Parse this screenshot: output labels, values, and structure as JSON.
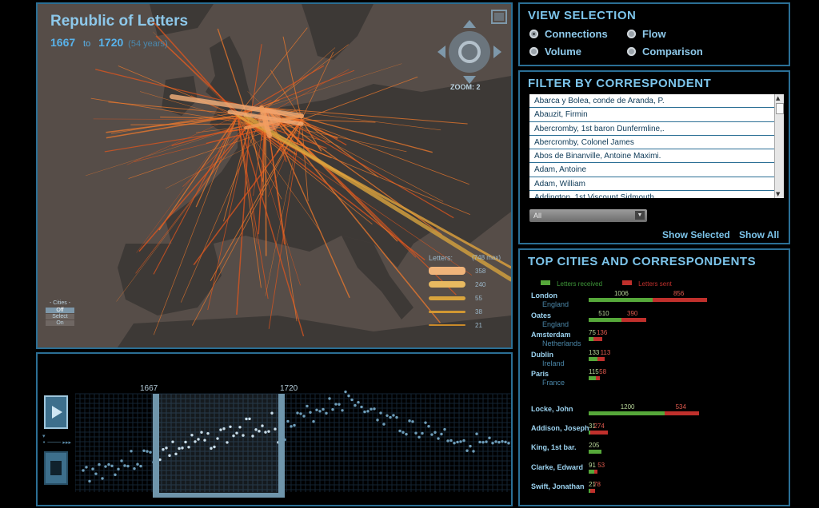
{
  "map": {
    "title": "Republic of Letters",
    "start_year": "1667",
    "to_label": "to",
    "end_year": "1720",
    "duration": "(54 years)",
    "zoom_label": "ZOOM:",
    "zoom_value": "2",
    "cities_toggle": {
      "title": "- Cities -",
      "options": [
        "Off",
        "Select",
        "On"
      ],
      "selected": "Off"
    },
    "legend": {
      "title": "Letters:",
      "max": "(748 max)",
      "entries": [
        {
          "value": "358",
          "color": "#f0b47a"
        },
        {
          "value": "240",
          "color": "#e8b960"
        },
        {
          "value": "55",
          "color": "#d9a43d"
        },
        {
          "value": "38",
          "color": "#d19732"
        },
        {
          "value": "21",
          "color": "#c98a2a"
        }
      ]
    }
  },
  "timeline": {
    "range_start_label": "1667",
    "range_end_label": "1720",
    "play_icon": "play-icon",
    "stop_icon": "stop-icon"
  },
  "view_selection": {
    "title": "VIEW SELECTION",
    "options": [
      {
        "label": "Connections",
        "selected": true
      },
      {
        "label": "Flow",
        "selected": false
      },
      {
        "label": "Volume",
        "selected": false
      },
      {
        "label": "Comparison",
        "selected": false
      }
    ]
  },
  "filter": {
    "title": "FILTER BY CORRESPONDENT",
    "correspondents": [
      "Abarca y Bolea, conde de Aranda, P.",
      "Abauzit, Firmin",
      "Abercromby, 1st baron Dunfermline,.",
      "Abercromby, Colonel James",
      "Abos de Binanville, Antoine Maximi.",
      "Adam, Antoine",
      "Adam, William",
      "Addington, 1st Viscount Sidmouth"
    ],
    "dropdown_value": "All",
    "show_selected": "Show Selected",
    "show_all": "Show All"
  },
  "top": {
    "title": "TOP CITIES AND CORRESPONDENTS",
    "legend_received": "Letters received",
    "legend_sent": "Letters sent",
    "received_color": "#56a83a",
    "sent_color": "#c0302c",
    "cities": [
      {
        "name": "London",
        "country": "England",
        "received": "1006",
        "sent": "856",
        "r": 1006,
        "s": 856
      },
      {
        "name": "Oates",
        "country": "England",
        "received": "510",
        "sent": "390",
        "r": 510,
        "s": 390
      },
      {
        "name": "Amsterdam",
        "country": "Netherlands",
        "received": "75",
        "sent": "136",
        "r": 75,
        "s": 136
      },
      {
        "name": "Dublin",
        "country": "Ireland",
        "received": "133",
        "sent": "113",
        "r": 133,
        "s": 113
      },
      {
        "name": "Paris",
        "country": "France",
        "received": "115",
        "sent": "58",
        "r": 115,
        "s": 58
      }
    ],
    "correspondents": [
      {
        "name": "Locke, John",
        "received": "1200",
        "sent": "534",
        "r": 1200,
        "s": 534
      },
      {
        "name": "Addison, Joseph",
        "received": "31",
        "sent": "274",
        "r": 31,
        "s": 274
      },
      {
        "name": "King, 1st bar.",
        "received": "205",
        "sent": "",
        "r": 205,
        "s": 0
      },
      {
        "name": "Clarke, Edward",
        "received": "91",
        "sent": "53",
        "r": 91,
        "s": 53
      },
      {
        "name": "Swift, Jonathan",
        "received": "21",
        "sent": "78",
        "r": 21,
        "s": 78
      }
    ]
  }
}
